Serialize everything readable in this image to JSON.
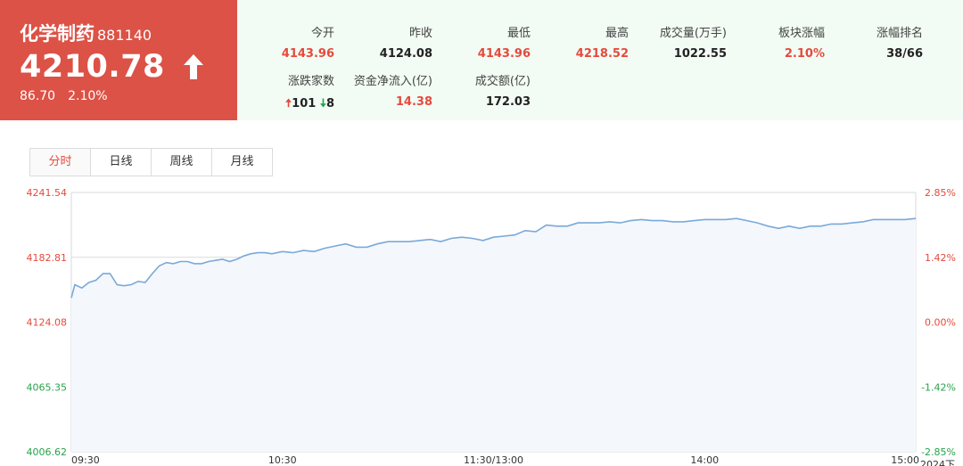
{
  "header": {
    "name": "化学制药",
    "code": "881140",
    "price": "4210.78",
    "change": "86.70",
    "change_pct": "2.10%",
    "stats": [
      {
        "label": "今开",
        "value": "4143.96",
        "tone": "up"
      },
      {
        "label": "昨收",
        "value": "4124.08",
        "tone": "blk"
      },
      {
        "label": "最低",
        "value": "4143.96",
        "tone": "up"
      },
      {
        "label": "最高",
        "value": "4218.52",
        "tone": "up"
      },
      {
        "label": "成交量(万手)",
        "value": "1022.55",
        "tone": "blk"
      },
      {
        "label": "板块涨幅",
        "value": "2.10%",
        "tone": "up"
      },
      {
        "label": "涨幅排名",
        "value": "38/66",
        "tone": "blk"
      },
      {
        "label": "涨跌家数",
        "value": "",
        "tone": "blk"
      },
      {
        "label": "资金净流入(亿)",
        "value": "14.38",
        "tone": "up"
      },
      {
        "label": "成交额(亿)",
        "value": "172.03",
        "tone": "blk"
      }
    ],
    "breadth": {
      "up": "101",
      "down": "8"
    }
  },
  "tabs": [
    "分时",
    "日线",
    "周线",
    "月线"
  ],
  "active_tab": 0,
  "colors": {
    "up": "#e54a3c",
    "down": "#27a24a",
    "line": "#7aa9d8",
    "fill": "#f4f7fc",
    "grid": "#dadada"
  },
  "chart_data": {
    "type": "line",
    "title": "",
    "x_ticks": [
      "09:30",
      "10:30",
      "11:30/13:00",
      "14:00",
      "15:00"
    ],
    "x_ticks_trailing": "2024下",
    "y_left_ticks": [
      "4241.54",
      "4182.81",
      "4124.08",
      "4065.35",
      "4006.62"
    ],
    "y_right_ticks": [
      "2.85%",
      "1.42%",
      "0.00%",
      "-1.42%",
      "-2.85%"
    ],
    "ylim": [
      4006.62,
      4241.54
    ],
    "prev_close": 4124.08,
    "sessions": 240,
    "series": [
      {
        "x": [
          0,
          1,
          3,
          5,
          7,
          9,
          11,
          13,
          15,
          17,
          19,
          21,
          23,
          25,
          27,
          29,
          31,
          33,
          35,
          37,
          39,
          41,
          43,
          45,
          47,
          49,
          51,
          53,
          55,
          57,
          60,
          63,
          66,
          69,
          72,
          75,
          78,
          81,
          84,
          87,
          90,
          93,
          96,
          99,
          102,
          105,
          108,
          111,
          114,
          117,
          120,
          123,
          126,
          129,
          132,
          135,
          138,
          141,
          144,
          147,
          150,
          153,
          156,
          159,
          162,
          165,
          168,
          171,
          174,
          177,
          180,
          183,
          186,
          189,
          192,
          195,
          198,
          201,
          204,
          207,
          210,
          213,
          216,
          219,
          222,
          225,
          228,
          231,
          234,
          237,
          240
        ],
        "values": [
          4146,
          4158,
          4155,
          4160,
          4162,
          4168,
          4168,
          4158,
          4157,
          4158,
          4161,
          4160,
          4168,
          4175,
          4178,
          4177,
          4179,
          4179,
          4177,
          4177,
          4179,
          4180,
          4181,
          4179,
          4181,
          4184,
          4186,
          4187,
          4187,
          4186,
          4188,
          4187,
          4189,
          4188,
          4191,
          4193,
          4195,
          4192,
          4192,
          4195,
          4197,
          4197,
          4197,
          4198,
          4199,
          4197,
          4200,
          4201,
          4200,
          4198,
          4201,
          4202,
          4203,
          4207,
          4206,
          4212,
          4211,
          4211,
          4214,
          4214,
          4214,
          4215,
          4214,
          4216,
          4217,
          4216,
          4216,
          4215,
          4215,
          4216,
          4217,
          4217,
          4217,
          4218,
          4216,
          4214,
          4211,
          4209,
          4211,
          4209,
          4211,
          4211,
          4213,
          4213,
          4214,
          4215,
          4217,
          4217,
          4217,
          4217,
          4218
        ]
      }
    ]
  }
}
